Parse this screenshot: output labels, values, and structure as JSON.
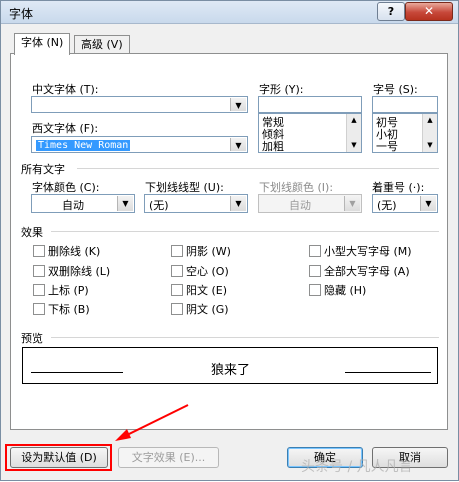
{
  "window": {
    "title": "字体",
    "help_label": "?",
    "close_label": "✕"
  },
  "tabs": [
    {
      "label": "字体 (N)"
    },
    {
      "label": "高级 (V)"
    }
  ],
  "font_section": {
    "chinese_font_label": "中文字体 (T):",
    "chinese_font_value": "",
    "western_font_label": "西文字体 (F):",
    "western_font_value": "Times New Roman",
    "style_label": "字形 (Y):",
    "style_value": "",
    "style_options": [
      "常规",
      "倾斜",
      "加粗"
    ],
    "size_label": "字号 (S):",
    "size_value": "",
    "size_options": [
      "初号",
      "小初",
      "一号"
    ]
  },
  "all_text": {
    "heading": "所有文字",
    "font_color_label": "字体颜色 (C):",
    "font_color_value": "自动",
    "underline_style_label": "下划线线型 (U):",
    "underline_style_value": "(无)",
    "underline_color_label": "下划线颜色 (I):",
    "underline_color_value": "自动",
    "emphasis_label": "着重号 (·):",
    "emphasis_value": "(无)"
  },
  "effects": {
    "heading": "效果",
    "items": [
      {
        "label": "删除线 (K)"
      },
      {
        "label": "双删除线 (L)"
      },
      {
        "label": "上标 (P)"
      },
      {
        "label": "下标 (B)"
      },
      {
        "label": "阴影 (W)"
      },
      {
        "label": "空心 (O)"
      },
      {
        "label": "阳文 (E)"
      },
      {
        "label": "阴文 (G)"
      },
      {
        "label": "小型大写字母 (M)"
      },
      {
        "label": "全部大写字母 (A)"
      },
      {
        "label": "隐藏 (H)"
      }
    ]
  },
  "preview": {
    "heading": "预览",
    "text": "狼来了"
  },
  "buttons": {
    "set_default": "设为默认值 (D)",
    "text_effects": "文字效果 (E)...",
    "ok": "确定",
    "cancel": "取消"
  },
  "watermark": "头条号 / 凡人凡言",
  "colors": {
    "annotation": "#ff0000",
    "selection": "#3399ff"
  }
}
